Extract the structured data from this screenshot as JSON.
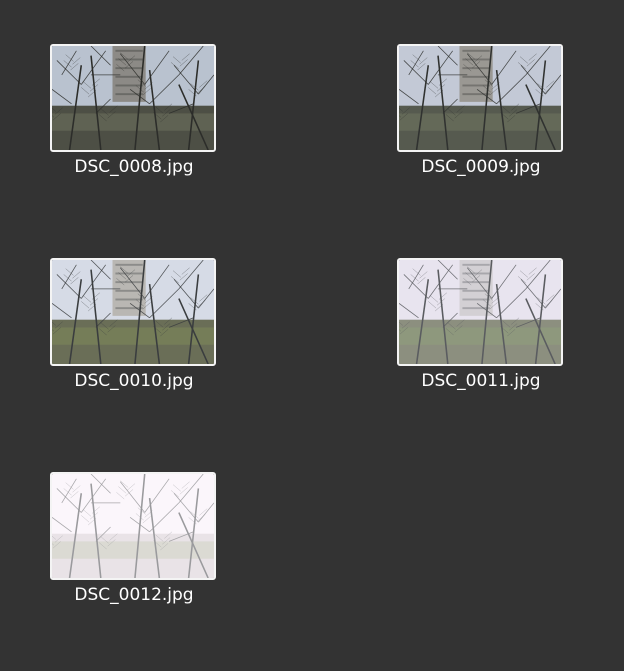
{
  "files": [
    {
      "name": "DSC_0008.jpg",
      "thumb": {
        "sky": "#b9c2cf",
        "ground": "#4d4f45",
        "branch": "#2c2d2a",
        "building": "#8c8a86",
        "tint": "#6f735e"
      }
    },
    {
      "name": "DSC_0009.jpg",
      "thumb": {
        "sky": "#c3c9d6",
        "ground": "#565a4f",
        "branch": "#303230",
        "building": "#9a9893",
        "tint": "#717760"
      }
    },
    {
      "name": "DSC_0010.jpg",
      "thumb": {
        "sky": "#d6dbe6",
        "ground": "#6a6e57",
        "branch": "#3a3d3f",
        "building": "#b9b7b3",
        "tint": "#7d8a59"
      }
    },
    {
      "name": "DSC_0011.jpg",
      "thumb": {
        "sky": "#e8e4ef",
        "ground": "#8c8f7f",
        "branch": "#5a5c60",
        "building": "#d3d0d4",
        "tint": "#8fa07b"
      }
    },
    {
      "name": "DSC_0012.jpg",
      "thumb": {
        "sky": "#fbf6fb",
        "ground": "#e9e3e7",
        "branch": "#9a9a9d",
        "building": "#f4eff3",
        "tint": "#cfd4c2"
      }
    }
  ]
}
